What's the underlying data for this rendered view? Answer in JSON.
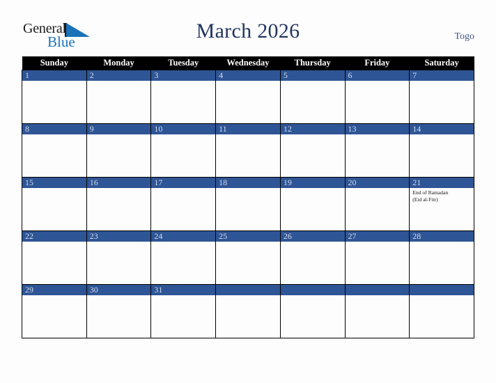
{
  "brand": {
    "word_one": "General",
    "word_two": "Blue",
    "accent_color": "#1b72b8"
  },
  "header": {
    "title": "March 2026",
    "country": "Togo",
    "title_color": "#21365f"
  },
  "calendar": {
    "header_bg": "#000000",
    "daynum_bg": "#2e5596",
    "weekdays": [
      "Sunday",
      "Monday",
      "Tuesday",
      "Wednesday",
      "Thursday",
      "Friday",
      "Saturday"
    ],
    "weeks": [
      [
        {
          "day": "1",
          "events": []
        },
        {
          "day": "2",
          "events": []
        },
        {
          "day": "3",
          "events": []
        },
        {
          "day": "4",
          "events": []
        },
        {
          "day": "5",
          "events": []
        },
        {
          "day": "6",
          "events": []
        },
        {
          "day": "7",
          "events": []
        }
      ],
      [
        {
          "day": "8",
          "events": []
        },
        {
          "day": "9",
          "events": []
        },
        {
          "day": "10",
          "events": []
        },
        {
          "day": "11",
          "events": []
        },
        {
          "day": "12",
          "events": []
        },
        {
          "day": "13",
          "events": []
        },
        {
          "day": "14",
          "events": []
        }
      ],
      [
        {
          "day": "15",
          "events": []
        },
        {
          "day": "16",
          "events": []
        },
        {
          "day": "17",
          "events": []
        },
        {
          "day": "18",
          "events": []
        },
        {
          "day": "19",
          "events": []
        },
        {
          "day": "20",
          "events": []
        },
        {
          "day": "21",
          "events": [
            "End of Ramadan",
            "(Eid al-Fitr)"
          ]
        }
      ],
      [
        {
          "day": "22",
          "events": []
        },
        {
          "day": "23",
          "events": []
        },
        {
          "day": "24",
          "events": []
        },
        {
          "day": "25",
          "events": []
        },
        {
          "day": "26",
          "events": []
        },
        {
          "day": "27",
          "events": []
        },
        {
          "day": "28",
          "events": []
        }
      ],
      [
        {
          "day": "29",
          "events": []
        },
        {
          "day": "30",
          "events": []
        },
        {
          "day": "31",
          "events": []
        },
        {
          "day": "",
          "events": []
        },
        {
          "day": "",
          "events": []
        },
        {
          "day": "",
          "events": []
        },
        {
          "day": "",
          "events": []
        }
      ]
    ]
  }
}
